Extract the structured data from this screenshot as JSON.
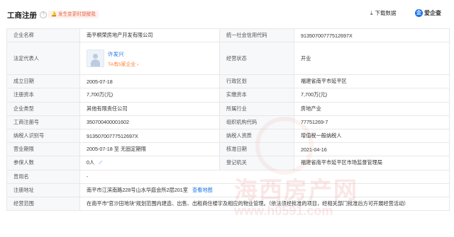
{
  "header": {
    "title": "工商注册",
    "help": "?",
    "alert": "发生变更时提醒我",
    "download": "下载数据",
    "brand": "爱企查"
  },
  "rows": [
    {
      "l1": "企业名称",
      "v1": "南平桐荣房地产开发有限公司",
      "l2": "统一社会信用代码",
      "v2": "91350700777512697X"
    },
    {
      "l1": "法定代表人",
      "rep_name": "许发兴",
      "rep_sub": "TA有5家企业 ›",
      "l2": "经营状态",
      "v2": "开业"
    },
    {
      "l1": "成立日期",
      "v1": "2005-07-18",
      "l2": "行政区划",
      "v2": "福建省南平市延平区"
    },
    {
      "l1": "注册资本",
      "v1": "7,700万(元)",
      "l2": "实缴资本",
      "v2": "7,700万(元)"
    },
    {
      "l1": "企业类型",
      "v1": "其他有限责任公司",
      "l2": "所属行业",
      "v2": "房地产业"
    },
    {
      "l1": "工商注册号",
      "v1": "350700400001602",
      "l2": "组织机构代码",
      "v2": "77751269-7"
    },
    {
      "l1": "纳税人识别号",
      "v1": "91350700777512697X",
      "l2": "纳税人资质",
      "v2": "增值税一般纳税人"
    },
    {
      "l1": "营业期限",
      "v1": "2005-07-18 至 无固定期限",
      "l2": "核准日期",
      "v2": "2021-04-16"
    },
    {
      "l1": "参保人数",
      "v1": "0人",
      "l2": "登记机关",
      "v2": "福建省南平市延平区市场监督管理局"
    },
    {
      "l1": "曾用名",
      "v1": "-"
    },
    {
      "l1": "注册地址",
      "v1": "南平市江滨南路228号山水华庭会所2层201室",
      "link": "查看地图"
    },
    {
      "l1": "经营范围",
      "v1": "在南平市\"官沙田地块\"规划范围内建造、出售、出租商住楼宇及相应的物业管理。（依法须经批准的项目，经相关部门批准后方可开展经营活动）"
    }
  ],
  "watermark": {
    "line1": "海西房产网",
    "line2": "www.h0591.com"
  }
}
